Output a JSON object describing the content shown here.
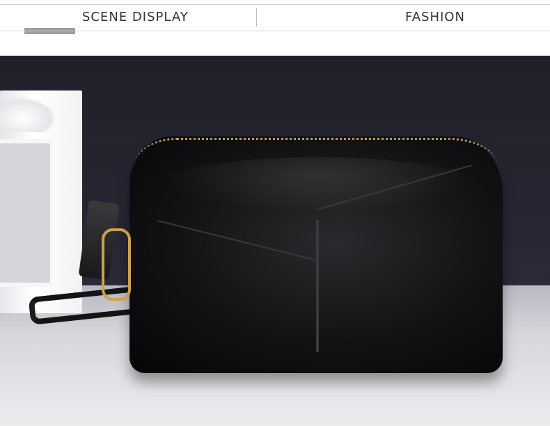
{
  "header": {
    "tabs": [
      {
        "label": "SCENE DISPLAY",
        "active": true
      },
      {
        "label": "FASHION",
        "active": false
      }
    ]
  },
  "photo": {
    "subject": "",
    "colors": {
      "background": "#262632",
      "surface": "#d8d6dc",
      "bag": "#121214",
      "hardware": "#c9a24a"
    }
  }
}
